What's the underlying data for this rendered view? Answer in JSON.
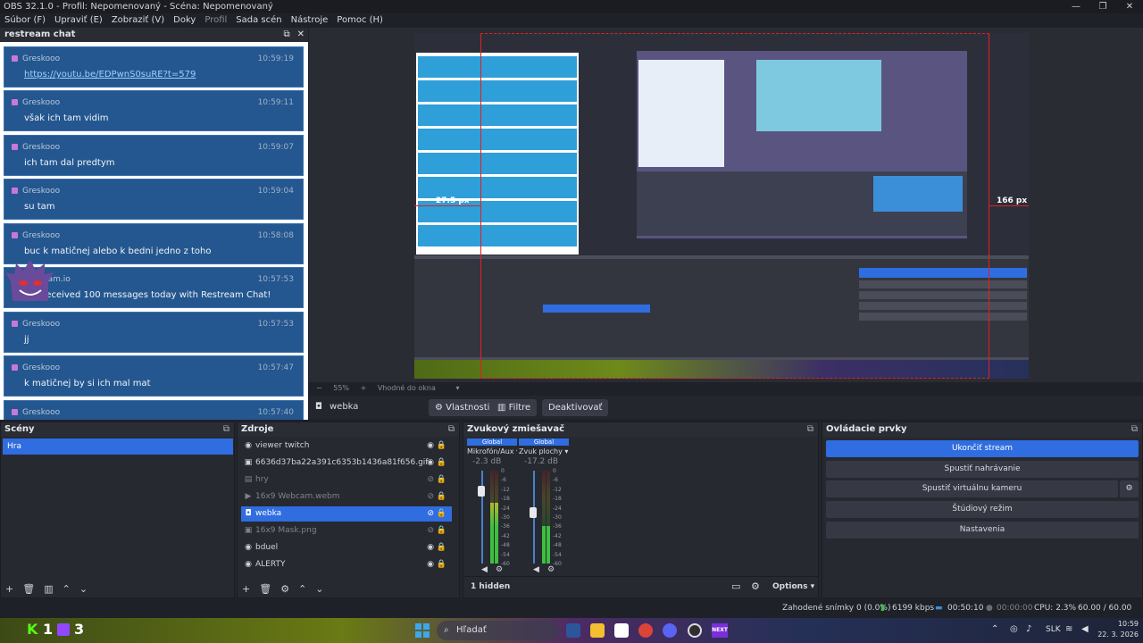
{
  "window": {
    "title": "OBS 32.1.0 - Profil: Nepomenovaný - Scéna: Nepomenovaný",
    "controls": [
      "—",
      "❐",
      "✕"
    ]
  },
  "menu": {
    "items": [
      "Súbor (F)",
      "Upraviť (E)",
      "Zobraziť (V)",
      "Doky",
      "Profil",
      "Sada scén",
      "Nástroje",
      "Pomoc (H)"
    ]
  },
  "chat": {
    "title": "restream chat",
    "messages": [
      {
        "user": "Greskooo",
        "time": "10:59:19",
        "text": "https://youtu.be/EDPwnS0suRE?t=579"
      },
      {
        "user": "Greskooo",
        "time": "10:59:11",
        "text": "však ich tam vidim"
      },
      {
        "user": "Greskooo",
        "time": "10:59:07",
        "text": "ich tam dal predtym"
      },
      {
        "user": "Greskooo",
        "time": "10:59:04",
        "text": "su tam"
      },
      {
        "user": "Greskooo",
        "time": "10:58:08",
        "text": "buc k matičnej alebo k bedni jedno z toho"
      },
      {
        "user": "Restream.io",
        "time": "10:57:53",
        "text": "You received 100 messages today with Restream Chat!"
      },
      {
        "user": "Greskooo",
        "time": "10:57:53",
        "text": "jj"
      },
      {
        "user": "Greskooo",
        "time": "10:57:47",
        "text": "k matičnej by si ich mal mat"
      },
      {
        "user": "Greskooo",
        "time": "10:57:40",
        "text": ""
      }
    ]
  },
  "preview": {
    "measure_left": "27.5 px",
    "measure_right": "166 px",
    "zoom": "55%",
    "zoom_mode": "Vhodné do okna"
  },
  "source_toolbar": {
    "source_name": "webka",
    "properties": "Vlastnosti",
    "filters": "Filtre",
    "deactivate": "Deaktivovať"
  },
  "scenes": {
    "title": "Scény",
    "items": [
      "Hra"
    ]
  },
  "sources": {
    "title": "Zdroje",
    "items": [
      {
        "name": "viewer twitch",
        "icon": "globe-icon",
        "glyph": "◉",
        "visible": true,
        "selected": false
      },
      {
        "name": "6636d37ba22a391c6353b1436a81f656.gif",
        "icon": "image-icon",
        "glyph": "▣",
        "visible": true,
        "selected": false
      },
      {
        "name": "hry",
        "icon": "folder-icon",
        "glyph": "▤",
        "visible": false,
        "selected": false
      },
      {
        "name": "16x9 Webcam.webm",
        "icon": "play-icon",
        "glyph": "▶",
        "visible": false,
        "selected": false
      },
      {
        "name": "webka",
        "icon": "camera-icon",
        "glyph": "◘",
        "visible": false,
        "selected": true
      },
      {
        "name": "16x9 Mask.png",
        "icon": "image-icon",
        "glyph": "▣",
        "visible": false,
        "selected": false
      },
      {
        "name": "bduel",
        "icon": "globe-icon",
        "glyph": "◉",
        "visible": true,
        "selected": false
      },
      {
        "name": "ALERTY",
        "icon": "globe-icon",
        "glyph": "◉",
        "visible": true,
        "selected": false
      }
    ]
  },
  "mixer": {
    "title": "Zvukový zmiešavač",
    "channels": [
      {
        "tag": "Global",
        "name": "Mikrofón/Aux",
        "db": "-2.3 dB",
        "level": 0.35,
        "fader": 0.78
      },
      {
        "tag": "Global",
        "name": "Zvuk plochy",
        "db": "-17.2 dB",
        "level": 0.6,
        "fader": 0.55
      }
    ],
    "scale": [
      "0",
      "-6",
      "-12",
      "-18",
      "-24",
      "-30",
      "-36",
      "-42",
      "-48",
      "-54",
      "-60"
    ],
    "hidden": "1 hidden",
    "options": "Options"
  },
  "controls": {
    "title": "Ovládacie prvky",
    "buttons": [
      "Ukončiť stream",
      "Spustiť nahrávanie",
      "Spustiť virtuálnu kameru",
      "Štúdiový režim",
      "Nastavenia"
    ]
  },
  "status": {
    "dropped": "Zahodené snímky 0 (0.0%)",
    "bitrate": "6199 kbps",
    "stream_time": "00:50:10",
    "rec_time": "00:00:00",
    "cpu": "CPU: 2.3%",
    "fps": "60.00 / 60.00 FPS"
  },
  "taskbar": {
    "widget_k": "K",
    "widget_count1": "1",
    "widget_count2": "3",
    "search": "Hľadať",
    "lang": "SLK",
    "time": "10:59",
    "date": "22. 3. 2026",
    "next_label": "NEXT"
  },
  "colors": {
    "accent": "#2f6de0",
    "chat_bubble": "#24578f",
    "meter_green": "#3fbf3f",
    "meter_yellow": "#c8b82a",
    "meter_red": "#c03030",
    "guide_red": "#e02020"
  }
}
